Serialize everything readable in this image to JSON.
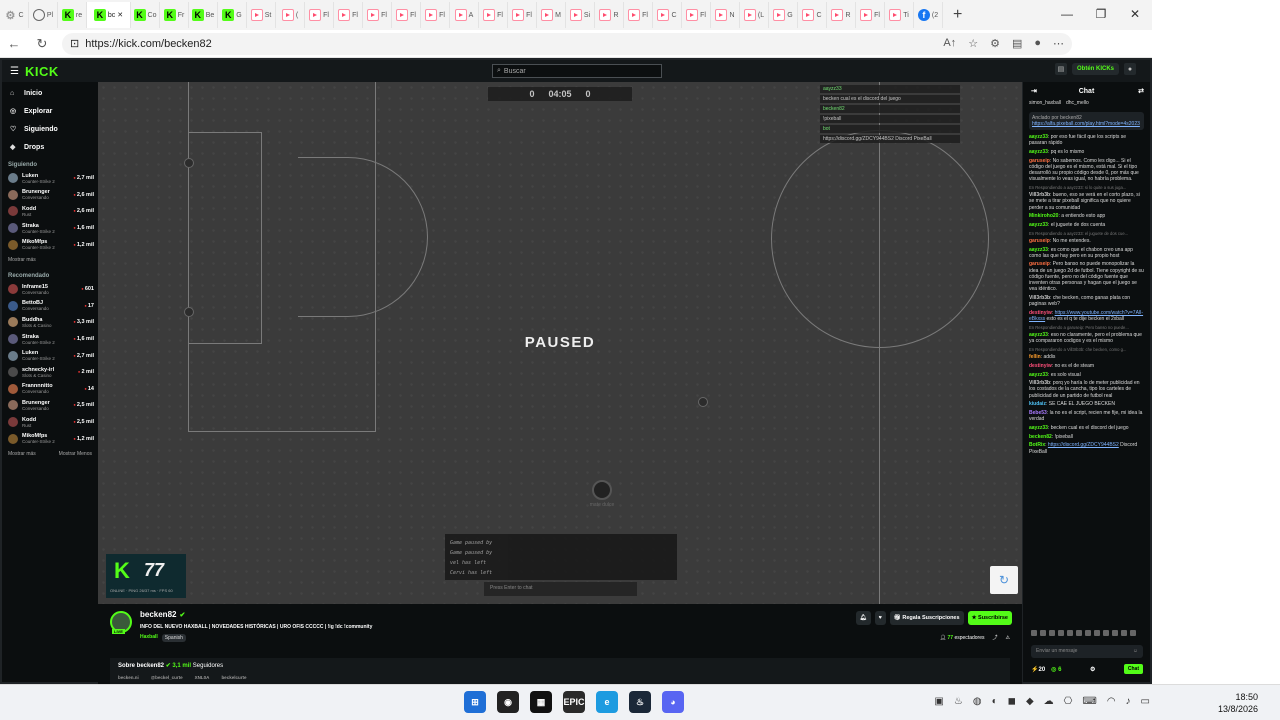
{
  "browser": {
    "tabs": [
      {
        "icon": "gear",
        "label": "C"
      },
      {
        "icon": "globe",
        "label": "Pl"
      },
      {
        "icon": "kick",
        "label": "re"
      },
      {
        "icon": "kick",
        "label": "bc",
        "active": true
      },
      {
        "icon": "kick",
        "label": "Co"
      },
      {
        "icon": "kick",
        "label": "Fr"
      },
      {
        "icon": "kick",
        "label": "Be"
      },
      {
        "icon": "kick",
        "label": "G"
      },
      {
        "icon": "yt",
        "label": "St"
      },
      {
        "icon": "yt",
        "label": "("
      },
      {
        "icon": "yt",
        "label": "Fl"
      },
      {
        "icon": "yt",
        "label": "Fl"
      },
      {
        "icon": "yt",
        "label": "Fl"
      },
      {
        "icon": "yt",
        "label": "Fl"
      },
      {
        "icon": "yt",
        "label": "Fl"
      },
      {
        "icon": "yt",
        "label": "A"
      },
      {
        "icon": "yt",
        "label": "Fl"
      },
      {
        "icon": "yt",
        "label": "Fl"
      },
      {
        "icon": "yt",
        "label": "M"
      },
      {
        "icon": "yt",
        "label": "Si"
      },
      {
        "icon": "yt",
        "label": "R"
      },
      {
        "icon": "yt",
        "label": "Fl"
      },
      {
        "icon": "yt",
        "label": "C"
      },
      {
        "icon": "yt",
        "label": "Fl"
      },
      {
        "icon": "yt",
        "label": "N"
      },
      {
        "icon": "yt",
        "label": "(L"
      },
      {
        "icon": "yt",
        "label": "G"
      },
      {
        "icon": "yt",
        "label": "C"
      },
      {
        "icon": "yt",
        "label": "R"
      },
      {
        "icon": "yt",
        "label": "Fl"
      },
      {
        "icon": "yt",
        "label": "Ti"
      },
      {
        "icon": "fb",
        "label": "(2"
      }
    ],
    "active_close": "✕",
    "new_tab": "+",
    "url": "https://kick.com/becken82"
  },
  "kick": {
    "logo": "KICK",
    "search_placeholder": "Buscar",
    "get_kicks": "Obtén KICKs",
    "nav": [
      {
        "icon": "⌂",
        "label": "Inicio"
      },
      {
        "icon": "◎",
        "label": "Explorar"
      },
      {
        "icon": "♡",
        "label": "Siguiendo"
      },
      {
        "icon": "◆",
        "label": "Drops"
      }
    ],
    "following_title": "Siguiendo",
    "following": [
      {
        "name": "Luken",
        "cat": "Counter-Strike 2",
        "viewers": "2,7 mil",
        "color": "#6a7c8a"
      },
      {
        "name": "Brunenger",
        "cat": "Conversando",
        "viewers": "2,6 mil",
        "color": "#8a6a5a"
      },
      {
        "name": "Kodd",
        "cat": "Rust",
        "viewers": "2,6 mil",
        "color": "#7a3a3a"
      },
      {
        "name": "Straka",
        "cat": "Counter-Strike 2",
        "viewers": "1,6 mil",
        "color": "#5a5a7a"
      },
      {
        "name": "MikoMfps",
        "cat": "Counter-Strike 2",
        "viewers": "1,2 mil",
        "color": "#7a5a2a"
      }
    ],
    "show_more": "Mostrar más",
    "recommended_title": "Recomendado",
    "recommended": [
      {
        "name": "Inframe15",
        "cat": "Conversando",
        "viewers": "601",
        "color": "#8a3a3a"
      },
      {
        "name": "BettoBJ",
        "cat": "Conversando",
        "viewers": "17",
        "color": "#3a5a8a"
      },
      {
        "name": "Buddha",
        "cat": "Slots & Casino",
        "viewers": "3,3 mil",
        "color": "#9a7a5a"
      },
      {
        "name": "Straka",
        "cat": "Counter-Strike 2",
        "viewers": "1,6 mil",
        "color": "#5a5a7a"
      },
      {
        "name": "Luken",
        "cat": "Counter-Strike 2",
        "viewers": "2,7 mil",
        "color": "#6a7c8a"
      },
      {
        "name": "schnecky-irl",
        "cat": "Slots & Casino",
        "viewers": "2 mil",
        "color": "#4a4a4a"
      },
      {
        "name": "Frannnnitto",
        "cat": "Conversando",
        "viewers": "14",
        "color": "#a05a3a"
      },
      {
        "name": "Brunenger",
        "cat": "Conversando",
        "viewers": "2,5 mil",
        "color": "#8a6a5a"
      },
      {
        "name": "Kodd",
        "cat": "Rust",
        "viewers": "2,5 mil",
        "color": "#7a3a3a"
      },
      {
        "name": "MikoMfps",
        "cat": "Counter-Strike 2",
        "viewers": "1,2 mil",
        "color": "#7a5a2a"
      }
    ],
    "show_more2": "Mostrar más",
    "show_less": "Mostrar Menos",
    "player": {
      "score_left": "0",
      "time": "04:05",
      "score_right": "0",
      "paused": "PAUSED",
      "game_chat": [
        {
          "name": "aayzz33",
          "text": ""
        },
        {
          "name": "",
          "text": "becken cual es el discord del juego"
        },
        {
          "name": "becken82",
          "text": ""
        },
        {
          "name": "",
          "text": "!pixeball"
        },
        {
          "name": "bot",
          "text": ""
        },
        {
          "name": "",
          "text": "https://discord.gg/ZDCY944BS2 Discord PixeBall"
        }
      ],
      "game_log": [
        "Game paused by",
        "Game paused by",
        "vel has left",
        "Cervi has left"
      ],
      "game_chat_placeholder": "Press Enter to chat",
      "avatar_label": "mate dulce",
      "overlay_num": "77",
      "overlay_stats": "ONLINE · PING 26/37 ms · FPS 60"
    },
    "stream": {
      "name": "becken82",
      "live": "LIVE",
      "title": "INFO DEL NUEVO HAXBALL | NOVEDADES HISTÓRICAS | URO OFIS CCCCC | !ig !dc !community",
      "category": "Haxball",
      "language": "Spanish",
      "gift_label": "Regala Suscripciones",
      "subscribe_label": "Suscribirse",
      "viewers": "77",
      "viewers_label": "espectadores",
      "about_prefix": "Sobre becken82",
      "followers": "3,1 mil",
      "followers_label": "Seguidores",
      "socials": [
        "becken.ni",
        "@beckel_curte",
        "XNL0A",
        "beckelcurte"
      ]
    },
    "chat": {
      "title": "Chat",
      "gifters": [
        "simon_haxball",
        "dhc_mello"
      ],
      "pinned_by": "Anclado por becken82",
      "pinned_link": "https://alfa.pixeball.com/play.html?mode=4s2023",
      "messages": [
        {
          "u": "aayzz33",
          "c": "#53fc18",
          "t": "por eso fue fácil que los scripts se pasaran rápido"
        },
        {
          "u": "aayzz33",
          "c": "#53fc18",
          "t": "pq es lo mismo"
        },
        {
          "u": "garuseip",
          "c": "#ff7043",
          "t": "No sabemos. Como les digo... Si el código del juego es el mismo, está mal. Si el tipo desarrolló su propio código desde 0, por más que visualmente lo veas igual, no habría problema."
        },
        {
          "r": "En Respondiendo a aayzz33: si lo quite a sus juga..."
        },
        {
          "u": "Vill3rb3b",
          "c": "#cccccc",
          "t": "bueno, eso se verá en el corto plazo, si se mete a tirar pixeball significa que no quiere perder a su comunidad"
        },
        {
          "u": "Minkiroho20",
          "c": "#53fc18",
          "t": "a entiendo esto app"
        },
        {
          "u": "aayzz33",
          "c": "#53fc18",
          "t": "el juguete de dos cuenta"
        },
        {
          "r": "En Respondiendo a aayzz33: el juguete de dos cue..."
        },
        {
          "u": "garuseip",
          "c": "#ff7043",
          "t": "No me entendes."
        },
        {
          "u": "aayzz33",
          "c": "#53fc18",
          "t": "es como que el chabon creo una app como las que hay pero en su propio host"
        },
        {
          "u": "garuseip",
          "c": "#ff7043",
          "t": "Pero banso no puede monopolizar la idea de un juego 2d de futbol. Tiene copyright de su código fuente, pero no del código fuente que inventen otras personas y hagan que el juego se vea idéntico."
        },
        {
          "u": "Vill3rb3b",
          "c": "#cccccc",
          "t": "che becken, como ganas plata con paginas web?"
        },
        {
          "u": "destinyiw",
          "c": "#ff4f7a",
          "t": "esto es el q te dije becken el 2xball",
          "l": "https://www.youtube.com/watch?v=7AlI-eBkxss"
        },
        {
          "r": "En Respondiendo a garuseip: Pero banso no puede..."
        },
        {
          "u": "aayzz33",
          "c": "#53fc18",
          "t": "eso no claramente, pero el problema que ya compararon codigos y es el mismo"
        },
        {
          "r": "En Respondiendo a Vill3rb3b: che becken, como g..."
        },
        {
          "u": "fellin",
          "c": "#ff9e2c",
          "t": "addis"
        },
        {
          "u": "destinyiw",
          "c": "#ff4f7a",
          "t": "no es el de steam"
        },
        {
          "u": "aayzz33",
          "c": "#53fc18",
          "t": "es solo visual"
        },
        {
          "u": "Vill3rb3b",
          "c": "#cccccc",
          "t": "porq yo haría lo de meter publicidad en los costados de la cancha, tipo los carteles de publicidad de un partido de futbol real"
        },
        {
          "u": "kiudaiz",
          "c": "#4fc3f7",
          "t": "SE CAE EL JUEGO BECKEN"
        },
        {
          "u": "Bebe53",
          "c": "#ab7bff",
          "t": "la no es el script, recien me fije, mi idea la verdad"
        },
        {
          "u": "aayzz33",
          "c": "#53fc18",
          "t": "becken cual es el discord del juego"
        },
        {
          "u": "becken82",
          "c": "#53fc18",
          "t": "!pixeball"
        },
        {
          "u": "BotRix",
          "c": "#53fc18",
          "t": "Discord PixeBall",
          "l": "https://discord.gg/ZDCY944BS2"
        }
      ],
      "input_placeholder": "Enviar un mensaje",
      "points": "20",
      "kicks": "6",
      "send": "Chat"
    }
  },
  "taskbar": {
    "apps": [
      {
        "name": "start",
        "label": "⊞",
        "color": "#1f6fd6"
      },
      {
        "name": "app-dark-circle",
        "label": "◉",
        "color": "#222"
      },
      {
        "name": "app-capcut",
        "label": "▦",
        "color": "#111"
      },
      {
        "name": "app-epic",
        "label": "EPIC",
        "color": "#2a2a2a"
      },
      {
        "name": "app-edge",
        "label": "e",
        "color": "#1d9be0"
      },
      {
        "name": "app-steam",
        "label": "♨",
        "color": "#1b2838"
      },
      {
        "name": "app-discord",
        "label": "◕",
        "color": "#5865f2"
      }
    ],
    "time": "18:50",
    "date": "13/8/2026"
  }
}
